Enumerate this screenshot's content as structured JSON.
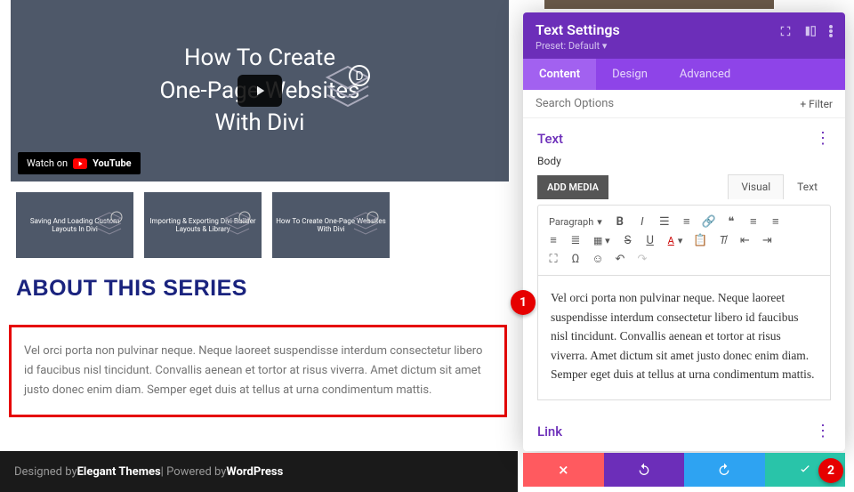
{
  "video": {
    "title_l1": "How To Create",
    "title_l2": "One-Page Websites",
    "title_l3": "With Divi",
    "watch_label": "Watch on",
    "yt_label": "YouTube"
  },
  "thumbs": [
    {
      "label": "Saving And Loading Custom Layouts In Divi"
    },
    {
      "label": "Importing & Exporting Divi Builder Layouts & Library"
    },
    {
      "label": "How To Create One-Page Websites With Divi"
    }
  ],
  "series_heading": "ABOUT THIS SERIES",
  "body_text": "Vel orci porta non pulvinar neque. Neque laoreet suspendisse interdum consectetur libero id faucibus nisl tincidunt. Convallis aenean et tortor at risus viverra. Amet dictum sit amet justo donec enim diam. Semper eget duis at tellus at urna condimentum mattis.",
  "footer": {
    "designed": "Designed by ",
    "theme": "Elegant Themes",
    "sep": " | Powered by ",
    "platform": "WordPress"
  },
  "panel": {
    "title": "Text Settings",
    "preset_label": "Preset: Default",
    "tabs": {
      "content": "Content",
      "design": "Design",
      "advanced": "Advanced"
    },
    "search_placeholder": "Search Options",
    "filter_label": "+  Filter",
    "section_text": "Text",
    "body_label": "Body",
    "add_media": "ADD MEDIA",
    "visual_tab": "Visual",
    "text_tab": "Text",
    "paragraph_sel": "Paragraph",
    "editor_content": "Vel orci porta non pulvinar neque. Neque laoreet suspendisse interdum consectetur libero id faucibus nisl tincidunt. Convallis aenean et tortor at risus viverra. Amet dictum sit amet justo donec enim diam. Semper eget duis at tellus at urna condimentum mattis.",
    "section_link": "Link"
  },
  "callouts": {
    "one": "1",
    "two": "2"
  },
  "colors": {
    "accent_purple": "#6c2eb9",
    "accent_red": "#e60000"
  }
}
